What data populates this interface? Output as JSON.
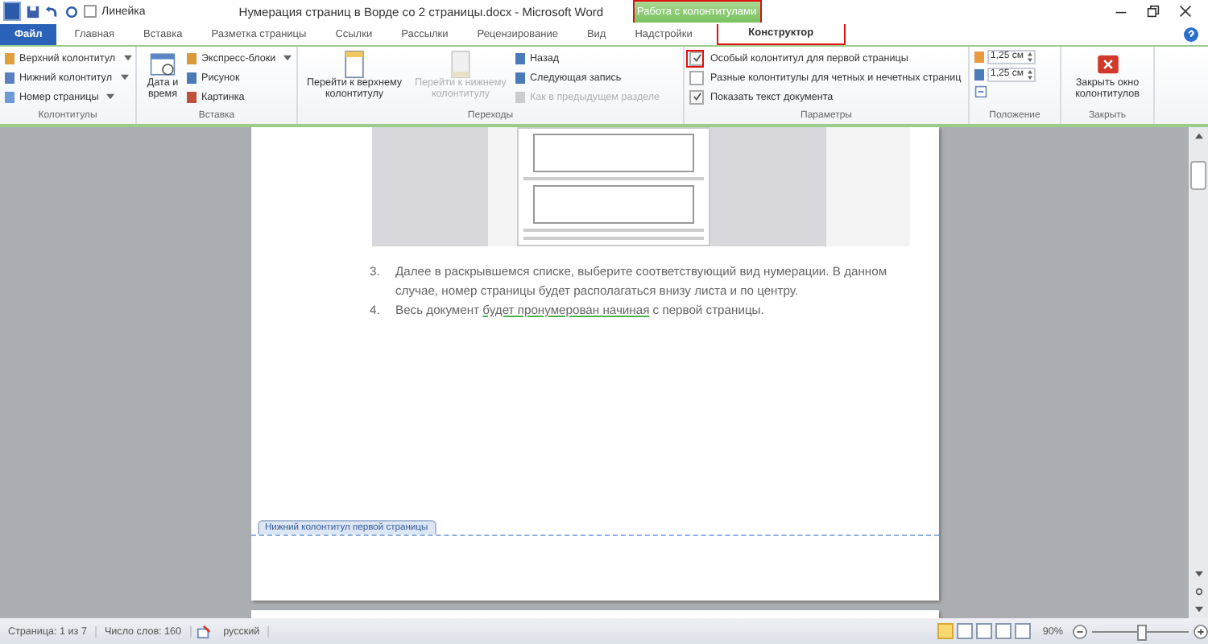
{
  "quick_access": {
    "ruler_label": "Линейка",
    "ruler_checked": false
  },
  "window": {
    "title": "Нумерация страниц в Ворде со 2 страницы.docx  -  Microsoft Word"
  },
  "contextual": {
    "group": "Работа с колонтитулами",
    "highlighted": true
  },
  "tabs": [
    {
      "label": "Файл",
      "kind": "file",
      "selected": false
    },
    {
      "label": "Главная",
      "kind": "normal",
      "selected": false
    },
    {
      "label": "Вставка",
      "kind": "normal",
      "selected": false
    },
    {
      "label": "Разметка страницы",
      "kind": "normal",
      "selected": false
    },
    {
      "label": "Ссылки",
      "kind": "normal",
      "selected": false
    },
    {
      "label": "Рассылки",
      "kind": "normal",
      "selected": false
    },
    {
      "label": "Рецензирование",
      "kind": "normal",
      "selected": false
    },
    {
      "label": "Вид",
      "kind": "normal",
      "selected": false
    },
    {
      "label": "Надстройки",
      "kind": "normal",
      "selected": false
    },
    {
      "label": "Конструктор",
      "kind": "contextual",
      "selected": true
    }
  ],
  "ribbon": {
    "headers": {
      "label": "Колонтитулы",
      "items": [
        {
          "label": "Верхний колонтитул"
        },
        {
          "label": "Нижний колонтитул"
        },
        {
          "label": "Номер страницы"
        }
      ]
    },
    "insert": {
      "label": "Вставка",
      "large": {
        "label": "Дата и время"
      },
      "items": [
        {
          "label": "Экспресс-блоки",
          "dropdown": true
        },
        {
          "label": "Рисунок",
          "dropdown": false
        },
        {
          "label": "Картинка",
          "dropdown": false
        }
      ]
    },
    "navigation": {
      "label": "Переходы",
      "large": [
        {
          "label": "Перейти к верхнему колонтитулу",
          "disabled": false
        },
        {
          "label": "Перейти к нижнему колонтитулу",
          "disabled": true
        }
      ],
      "items": [
        {
          "label": "Назад",
          "disabled": false
        },
        {
          "label": "Следующая запись",
          "disabled": false
        },
        {
          "label": "Как в предыдущем разделе",
          "disabled": true
        }
      ]
    },
    "options": {
      "label": "Параметры",
      "items": [
        {
          "label": "Особый колонтитул для первой страницы",
          "checked": true,
          "highlighted": true
        },
        {
          "label": "Разные колонтитулы для четных и нечетных страниц",
          "checked": false,
          "highlighted": false
        },
        {
          "label": "Показать текст документа",
          "checked": true,
          "highlighted": false
        }
      ]
    },
    "position": {
      "label": "Положение",
      "fields": [
        {
          "value": "1,25 см"
        },
        {
          "value": "1,25 см"
        }
      ]
    },
    "close": {
      "label": "Закрыть",
      "button": "Закрыть окно колонтитулов"
    }
  },
  "document": {
    "list": [
      {
        "number": "3.",
        "segments": [
          {
            "text": "Далее в раскрывшемся списке, выберите соответствующий вид нумерации. В данном случае, номер страницы будет располагаться внизу листа и по центру.",
            "underlined": false
          }
        ]
      },
      {
        "number": "4.",
        "segments": [
          {
            "text": "Весь документ ",
            "underlined": false
          },
          {
            "text": "будет пронумерован  начиная",
            "underlined": true
          },
          {
            "text": " с первой страницы.",
            "underlined": false
          }
        ]
      }
    ],
    "footer_label": "Нижний колонтитул первой страницы"
  },
  "status_bar": {
    "page": "Страница: 1 из 7",
    "words": "Число слов: 160",
    "language": "русский",
    "zoom": "90%",
    "zoom_slider": {
      "level": 0.5
    }
  }
}
